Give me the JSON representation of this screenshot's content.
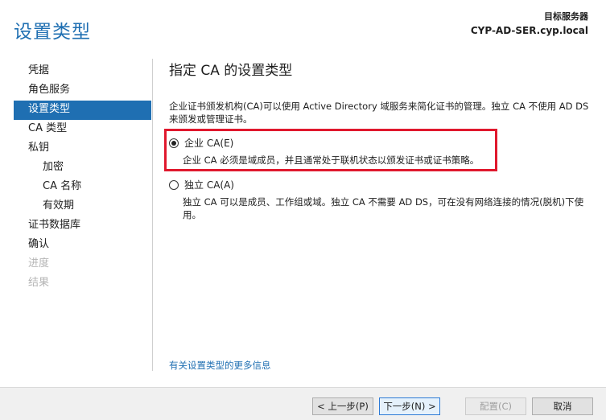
{
  "header": {
    "title": "设置类型",
    "target_label": "目标服务器",
    "target_value": "CYP-AD-SER.cyp.local"
  },
  "nav": {
    "items": [
      {
        "label": "凭据",
        "state": "normal",
        "sub": false
      },
      {
        "label": "角色服务",
        "state": "normal",
        "sub": false
      },
      {
        "label": "设置类型",
        "state": "active",
        "sub": false
      },
      {
        "label": "CA 类型",
        "state": "normal",
        "sub": false
      },
      {
        "label": "私钥",
        "state": "normal",
        "sub": false
      },
      {
        "label": "加密",
        "state": "normal",
        "sub": true
      },
      {
        "label": "CA 名称",
        "state": "normal",
        "sub": true
      },
      {
        "label": "有效期",
        "state": "normal",
        "sub": true
      },
      {
        "label": "证书数据库",
        "state": "normal",
        "sub": false
      },
      {
        "label": "确认",
        "state": "normal",
        "sub": false
      },
      {
        "label": "进度",
        "state": "disabled",
        "sub": false
      },
      {
        "label": "结果",
        "state": "disabled",
        "sub": false
      }
    ]
  },
  "main": {
    "section_title": "指定 CA 的设置类型",
    "description": "企业证书颁发机构(CA)可以使用 Active Directory 域服务来简化证书的管理。独立 CA 不使用 AD DS 来颁发或管理证书。",
    "options": {
      "enterprise": {
        "label": "企业 CA(E)",
        "description": "企业 CA 必须是域成员，并且通常处于联机状态以颁发证书或证书策略。",
        "selected": true
      },
      "standalone": {
        "label": "独立 CA(A)",
        "description": "独立 CA 可以是成员、工作组或域。独立 CA 不需要 AD DS，可在没有网络连接的情况(脱机)下使用。",
        "selected": false
      }
    },
    "more_info_link": "有关设置类型的更多信息"
  },
  "footer": {
    "prev_label": "< 上一步(P)",
    "next_label": "下一步(N) >",
    "configure_label": "配置(C)",
    "cancel_label": "取消"
  },
  "colors": {
    "accent": "#1f6fb2",
    "highlight_border": "#e0182d"
  }
}
